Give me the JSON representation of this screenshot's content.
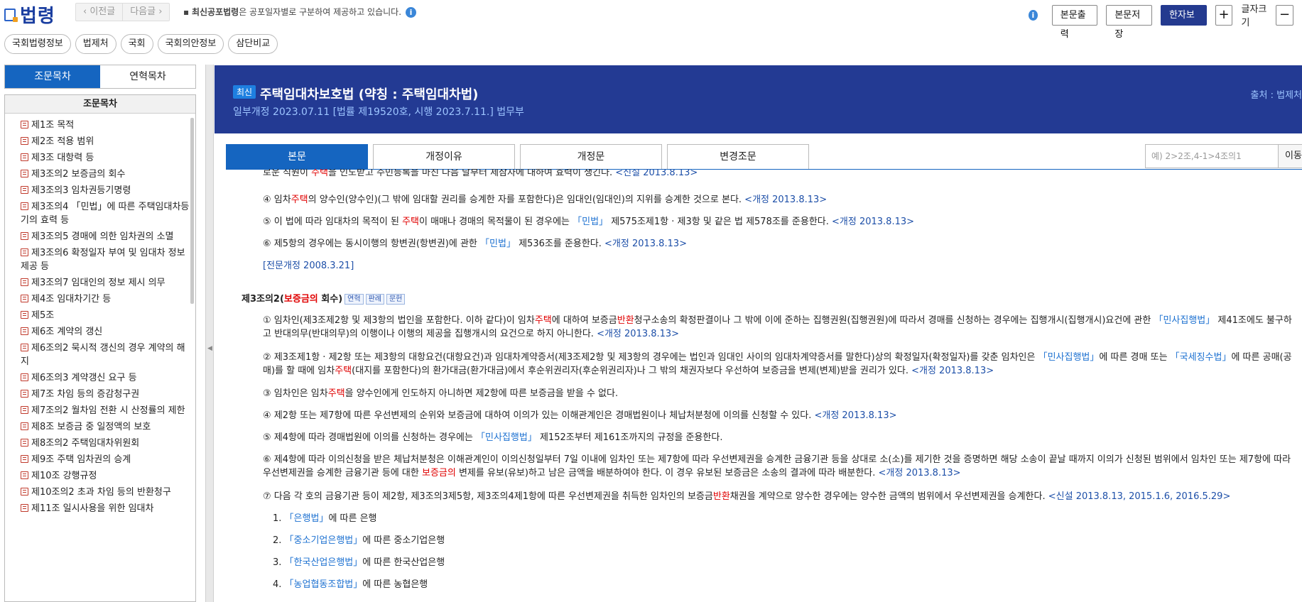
{
  "app": {
    "logo_text": "법령"
  },
  "history_nav": {
    "prev": "‹ 이전글",
    "next": "다음글 ›"
  },
  "notice": {
    "bold": "최신공포법령",
    "rest": "은 공포일자별로 구분하여 제공하고 있습니다.",
    "prefix": "▪ "
  },
  "top_buttons": {
    "print": "본문출력",
    "save": "본문저장",
    "hanja": "한자보기",
    "plus": "+",
    "font_label": "글자크기",
    "minus": "−"
  },
  "site_links": [
    "국회법령정보",
    "법제처",
    "국회",
    "국회의안정보",
    "삼단비교"
  ],
  "left_tabs": {
    "active": "조문목차",
    "other": "연혁목차"
  },
  "toc": {
    "heading": "조문목차",
    "items": [
      "제1조 목적",
      "제2조 적용 범위",
      "제3조 대항력 등",
      "제3조의2 보증금의 회수",
      "제3조의3 임차권등기명령",
      "제3조의4 「민법」에 따른 주택임대차등기의 효력 등",
      "제3조의5 경매에 의한 임차권의 소멸",
      "제3조의6 확정일자 부여 및 임대차 정보제공 등",
      "제3조의7 임대인의 정보 제시 의무",
      "제4조 임대차기간 등",
      "제5조",
      "제6조 계약의 갱신",
      "제6조의2 묵시적 갱신의 경우 계약의 해지",
      "제6조의3 계약갱신 요구 등",
      "제7조 차임 등의 증감청구권",
      "제7조의2 월차임 전환 시 산정률의 제한",
      "제8조 보증금 중 일정액의 보호",
      "제8조의2 주택임대차위원회",
      "제9조 주택 임차권의 승계",
      "제10조 강행규정",
      "제10조의2 초과 차임 등의 반환청구",
      "제11조 일시사용을 위한 임대차"
    ]
  },
  "law_header": {
    "badge": "최신",
    "title": "주택임대차보호법 (약칭 : 주택임대차법)",
    "subtitle": "일부개정 2023.07.11 [법률 제19520호, 시행 2023.7.11.] 법무부",
    "source": "출처 : 법제처"
  },
  "content_tabs": [
    "본문",
    "개정이유",
    "개정문",
    "변경조문"
  ],
  "search": {
    "placeholder": "예) 2>2조,4-1>4조의1",
    "go": "이동"
  },
  "body": {
    "l1_a": "로운 직원이 ",
    "l1_b": "주택",
    "l1_c": "을 인도받고 주민등록을 마친 다음 날부터 제삼자에 대하여 효력이 생긴다. ",
    "l1_d": "<신설 2013.8.13>",
    "l2_a": "④ 임차",
    "l2_b": "주택",
    "l2_c": "의 양수인(양수인)(그 밖에 임대할 권리를 승계한 자를 포함한다)은 임대인(임대인)의 지위를 승계한 것으로 본다. ",
    "l2_d": "<개정 2013.8.13>",
    "l3_a": "⑤ 이 법에 따라 임대차의 목적이 된 ",
    "l3_b": "주택",
    "l3_c": "이 매매나 경매의 목적물이 된 경우에는 ",
    "l3_d": "「민법」",
    "l3_e": " 제575조제1항 · 제3항 및 같은 법 제578조를 준용한다. ",
    "l3_f": "<개정 2013.8.13>",
    "l4_a": "⑥ 제5항의 경우에는 동시이행의 항변권(항변권)에 관한 ",
    "l4_b": "「민법」",
    "l4_c": " 제536조를 준용한다. ",
    "l4_d": "<개정 2013.8.13>",
    "l5": "[전문개정 2008.3.21]",
    "art_a": "제3조의2(",
    "art_b": "보증금의",
    "art_c": " 회수)",
    "tag1": "연혁",
    "tag2": "판례",
    "tag3": "문헌",
    "p1_a": "① 임차인(제3조제2항 및 제3항의 법인을 포함한다. 이하 같다)이 임차",
    "p1_b": "주택",
    "p1_c": "에 대하여 보증금",
    "p1_d": "반환",
    "p1_e": "청구소송의 확정판결이나 그 밖에 이에 준하는 집행권원(집행권원)에 따라서 경매를 신청하는 경우에는 집행개시(집행개시)요건에 관한 ",
    "p1_f": "「민사집행법」",
    "p1_g": " 제41조에도 불구하고 반대의무(반대의무)의 이행이나 이행의 제공을 집행개시의 요건으로 하지 아니한다. ",
    "p1_h": "<개정 2013.8.13>",
    "p2_a": "② 제3조제1항 · 제2항 또는 제3항의 대항요건(대항요건)과 임대차계약증서(제3조제2항 및 제3항의 경우에는 법인과 임대인 사이의 임대차계약증서를 말한다)상의 확정일자(확정일자)를 갖춘 임차인은 ",
    "p2_b": "「민사집행법」",
    "p2_c": "에 따른 경매 또는 ",
    "p2_d": "「국세징수법」",
    "p2_e": "에 따른 공매(공매)를 할 때에 임차",
    "p2_f": "주택",
    "p2_g": "(대지를 포함한다)의 환가대금(환가대금)에서 후순위권리자(후순위권리자)나 그 밖의 채권자보다 우선하여 보증금을 변제(변제)받을 권리가 있다. ",
    "p2_h": "<개정 2013.8.13>",
    "p3_a": "③ 임차인은 임차",
    "p3_b": "주택",
    "p3_c": "을 양수인에게 인도하지 아니하면 제2항에 따른 보증금을 받을 수 없다.",
    "p4_a": "④ 제2항 또는 제7항에 따른 우선변제의 순위와 보증금에 대하여 이의가 있는 이해관계인은 경매법원이나 체납처분청에 이의를 신청할 수 있다. ",
    "p4_b": "<개정 2013.8.13>",
    "p5_a": "⑤ 제4항에 따라 경매법원에 이의를 신청하는 경우에는 ",
    "p5_b": "「민사집행법」",
    "p5_c": " 제152조부터 제161조까지의 규정을 준용한다.",
    "p6_a": "⑥ 제4항에 따라 이의신청을 받은 체납처분청은 이해관계인이 이의신청일부터 7일 이내에 임차인 또는 제7항에 따라 우선변제권을 승계한 금융기관 등을 상대로 소(소)를 제기한 것을 증명하면 해당 소송이 끝날 때까지 이의가 신청된 범위에서 임차인 또는 제7항에 따라 우선변제권을 승계한 금융기관 등에 대한 ",
    "p6_b": "보증금의",
    "p6_c": " 변제를 유보(유보)하고 남은 금액을 배분하여야 한다. 이 경우 유보된 보증금은 소송의 결과에 따라 배분한다. ",
    "p6_d": "<개정 2013.8.13>",
    "p7_a": "⑦ 다음 각 호의 금융기관 등이 제2항, 제3조의3제5항, 제3조의4제1항에 따른 우선변제권을 취득한 임차인의 보증금",
    "p7_b": "반환",
    "p7_c": "채권을 계약으로 양수한 경우에는 양수한 금액의 범위에서 우선변제권을 승계한다. ",
    "p7_d": "<신설 2013.8.13, 2015.1.6, 2016.5.29>",
    "n1_no": "1. ",
    "n1_a": "「은행법」",
    "n1_b": "에 따른 은행",
    "n2_no": "2. ",
    "n2_a": "「중소기업은행법」",
    "n2_b": "에 따른 중소기업은행",
    "n3_no": "3. ",
    "n3_a": "「한국산업은행법」",
    "n3_b": "에 따른 한국산업은행",
    "n4_no": "4. ",
    "n4_a": "「농업협동조합법」",
    "n4_b": "에 따른 농협은행"
  }
}
